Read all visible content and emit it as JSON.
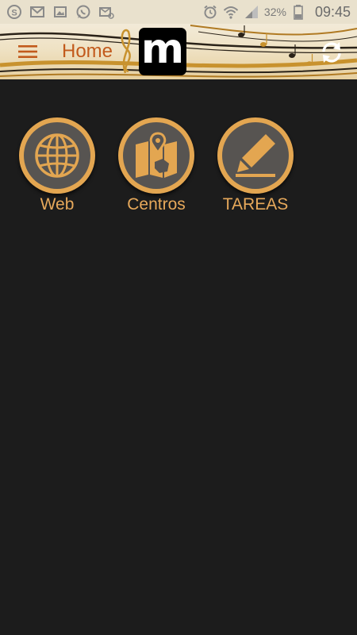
{
  "status_bar": {
    "icons": [
      "skype-icon",
      "gmail-icon",
      "image-icon",
      "whatsapp-icon",
      "email-icon"
    ],
    "alarm_icon": "alarm-icon",
    "wifi_icon": "wifi-icon",
    "signal_icon": "signal-icon",
    "battery_percent": "32%",
    "battery_icon": "battery-icon",
    "time": "09:45"
  },
  "header": {
    "title": "Home",
    "logo_letter": "m",
    "menu_icon": "menu-icon",
    "refresh_icon": "refresh-icon"
  },
  "tiles": [
    {
      "label": "Web",
      "icon": "globe-icon"
    },
    {
      "label": "Centros",
      "icon": "map-icon"
    },
    {
      "label": "TAREAS",
      "icon": "pencil-icon"
    }
  ],
  "colors": {
    "accent": "#e3a651",
    "title": "#c25a1c",
    "background": "#1c1c1c",
    "tile_inner": "#575451"
  }
}
